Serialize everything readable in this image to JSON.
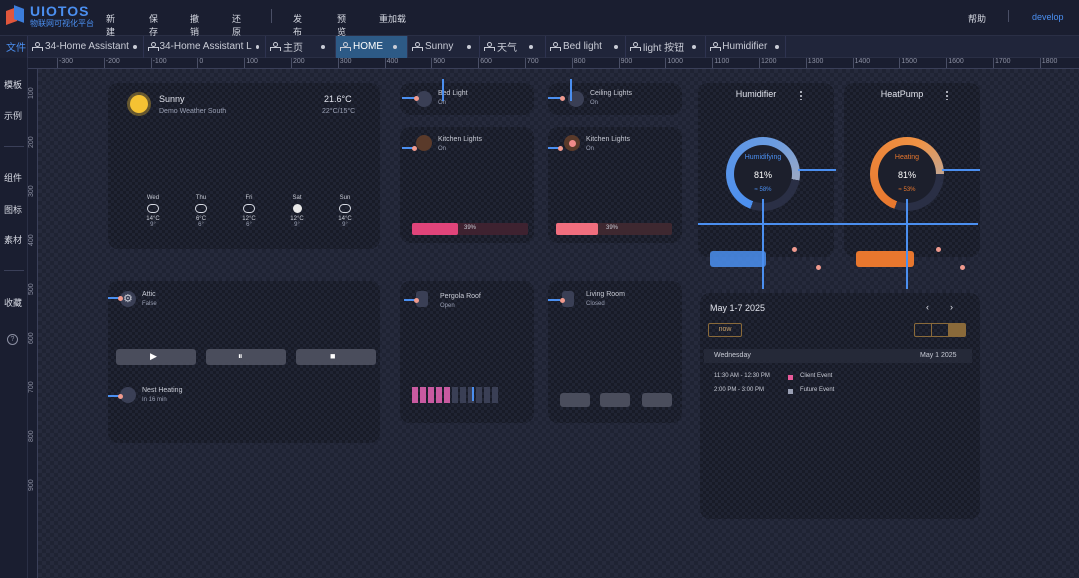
{
  "app": {
    "logo_title": "UIOTOS",
    "logo_subtitle": "物联网可视化平台",
    "help": "帮助",
    "user": "develop"
  },
  "menu": [
    "新建",
    "保存",
    "撤销",
    "还原",
    "发布",
    "预览",
    "重加载"
  ],
  "tabs": [
    {
      "label": "文件",
      "kind": "file"
    },
    {
      "label": "34-Home Assistant"
    },
    {
      "label": "34-Home Assistant L"
    },
    {
      "label": "主页"
    },
    {
      "label": "HOME",
      "active": true
    },
    {
      "label": "Sunny"
    },
    {
      "label": "天气"
    },
    {
      "label": "Bed light"
    },
    {
      "label": "light 按钮"
    },
    {
      "label": "Humidifier"
    }
  ],
  "ruler_h": [
    "-300",
    "-200",
    "-100",
    "0",
    "100",
    "200",
    "300",
    "400",
    "500",
    "600",
    "700",
    "800",
    "900",
    "1000",
    "1100",
    "1200",
    "1300",
    "1400",
    "1500",
    "1600",
    "1700",
    "1800"
  ],
  "ruler_v": [
    "100",
    "200",
    "300",
    "400",
    "500",
    "600",
    "700",
    "800",
    "900"
  ],
  "sidebar": [
    {
      "label": "模板"
    },
    {
      "label": "示例"
    },
    {
      "label": "组件"
    },
    {
      "label": "图标"
    },
    {
      "label": "素材"
    },
    {
      "label": "收藏"
    }
  ],
  "weather": {
    "condition": "Sunny",
    "location": "Demo Weather South",
    "temp": "21.6°C",
    "range": "22°C/15°C",
    "days": [
      {
        "day": "Wed",
        "hi": "14°C",
        "lo": "9°",
        "icon": "cloud-icon"
      },
      {
        "day": "Thu",
        "hi": "6°C",
        "lo": "6°",
        "icon": "cloud-icon"
      },
      {
        "day": "Fri",
        "hi": "12°C",
        "lo": "6°",
        "icon": "cloud-icon"
      },
      {
        "day": "Sat",
        "hi": "12°C",
        "lo": "9°",
        "icon": "sun-icon"
      },
      {
        "day": "Sun",
        "hi": "14°C",
        "lo": "9°",
        "icon": "partly-cloudy-icon"
      }
    ]
  },
  "lights": [
    {
      "name": "Bed Light",
      "state": "On"
    },
    {
      "name": "Ceiling Lights",
      "state": "On"
    },
    {
      "name": "Kitchen Lights",
      "state": "On",
      "level": "39%"
    },
    {
      "name": "Kitchen Lights",
      "state": "On",
      "level": "39%"
    }
  ],
  "misc": {
    "ac_name": "Attic",
    "ac_state": "False",
    "heat_name": "Nest Heating",
    "heat_state": "In 16 min",
    "pergola_name": "Pergola Roof",
    "pergola_state": "Open",
    "living_name": "Living Room",
    "living_state": "Closed"
  },
  "humidifier": {
    "title": "Humidifier",
    "mode": "Humidifying",
    "value": "81%",
    "sub": "≈ 58%",
    "color": "#4b8ff0"
  },
  "heatpump": {
    "title": "HeatPump",
    "mode": "Heating",
    "value": "81%",
    "sub": "≈ 53%",
    "color": "#e8772e"
  },
  "calendar": {
    "range": "May 1-7 2025",
    "today_btn": "now",
    "day": "Wednesday",
    "date": "May 1 2025",
    "events": [
      {
        "time": "11:30 AM - 12:30 PM",
        "title": "Client Event"
      },
      {
        "time": "2:00 PM - 3:00 PM",
        "title": "Future Event"
      }
    ]
  }
}
